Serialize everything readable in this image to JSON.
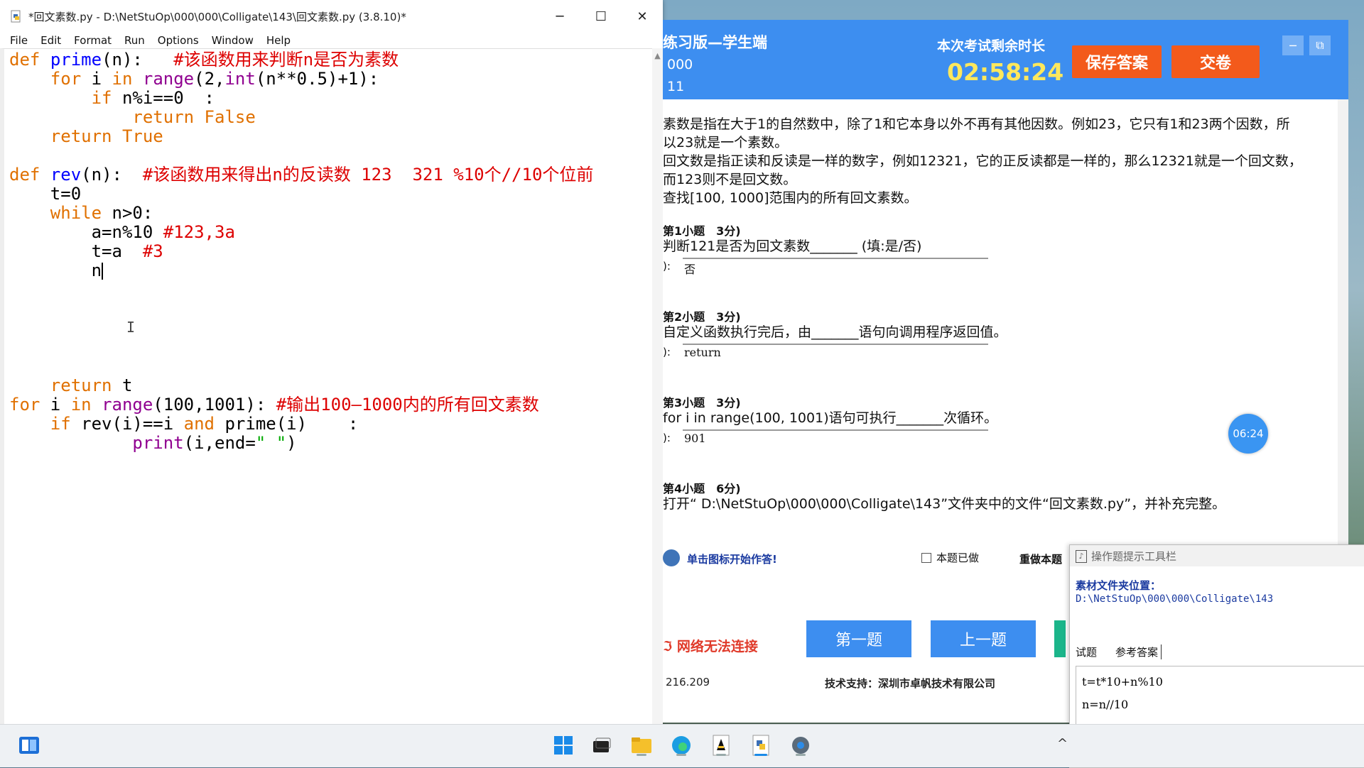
{
  "idle": {
    "title": "*回文素数.py - D:\\NetStuOp\\000\\000\\Colligate\\143\\回文素数.py (3.8.10)*",
    "menu": [
      "File",
      "Edit",
      "Format",
      "Run",
      "Options",
      "Window",
      "Help"
    ],
    "controls": {
      "minimize": "─",
      "maximize": "☐",
      "close": "✕"
    }
  },
  "exam": {
    "app_name": "练习版—学生端",
    "id1": "000",
    "id2": "11",
    "remain_label": "本次考试剩余时长",
    "timer": "02:58:24",
    "save_label": "保存答案",
    "submit_label": "交卷",
    "ctl_min": "─",
    "ctl_restore": "⧉",
    "desc_lines": [
      "素数是指在大于1的自然数中，除了1和它本身以外不再有其他因数。例如23，它只有1和23两个因数，所",
      "以23就是一个素数。",
      "回文数是指正读和反读是一样的数字，例如12321，它的正反读都是一样的，那么12321就是一个回文数，",
      "而123则不是回文数。",
      "查找[100, 1000]范围内的所有回文素数。"
    ],
    "questions": [
      {
        "header": "第1小题　3分)",
        "text": "判断121是否为回文素数_______ (填:是/否)",
        "answer_label": "):",
        "answer": "否"
      },
      {
        "header": "第2小题　3分)",
        "text": "自定义函数执行完后，由_______语句向调用程序返回值。",
        "answer_label": "):",
        "answer": "return"
      },
      {
        "header": "第3小题　3分)",
        "text": "for i in range(100, 1001)语句可执行_______次循环。",
        "answer_label": "):",
        "answer": "901"
      },
      {
        "header": "第4小题　6分)",
        "text": "打开“ D:\\NetStuOp\\000\\000\\Colligate\\143”文件夹中的文件“回文素数.py”，并补充完整。"
      }
    ],
    "start_label": "单击图标开始作答!",
    "done_label": "本题已做",
    "redo_label": "重做本题",
    "network_status": "网络无法连接",
    "first_label": "第一题",
    "prev_label": "上一题",
    "ip": "216.209",
    "support": "技术支持：深圳市卓帆技术有限公司",
    "circle_time": "06:24"
  },
  "toolpanel": {
    "title": "操作题提示工具栏",
    "folder_label": "素材文件夹位置：",
    "folder_path": "D:\\NetStuOp\\000\\000\\Colligate\\143",
    "tabs": [
      "试题",
      "参考答案"
    ],
    "ref_lines": [
      "t=t*10+n%10",
      "n=n//10"
    ]
  },
  "taskbar": {
    "icons": [
      "widgets-icon",
      "start-icon",
      "taskview-icon",
      "explorer-icon",
      "edge-icon",
      "exam-app-icon",
      "python-icon",
      "settings-icon"
    ],
    "chevron": "^"
  }
}
